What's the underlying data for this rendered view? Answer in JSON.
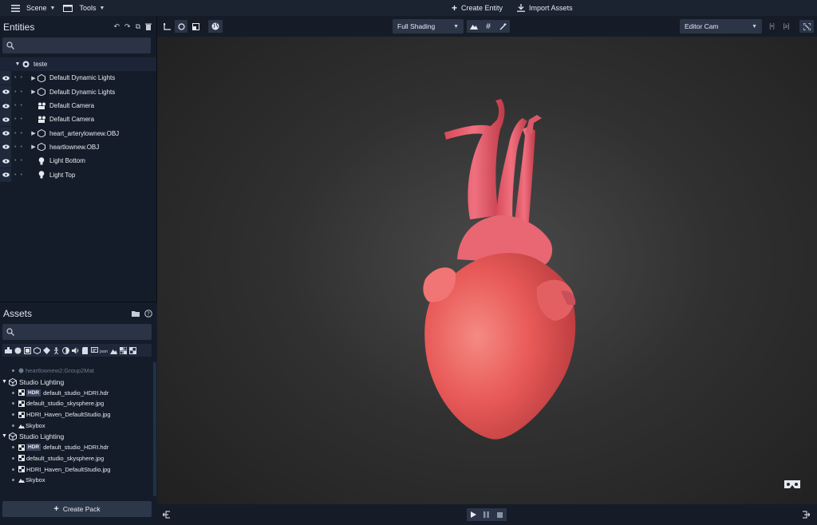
{
  "topbar": {
    "scene_label": "Scene",
    "tools_label": "Tools",
    "create_entity_label": "Create Entity",
    "import_assets_label": "Import Assets"
  },
  "entities": {
    "title": "Entities",
    "search_placeholder": "",
    "root": "teste",
    "items": [
      {
        "label": "Default Dynamic Lights",
        "icon": "cube-icon",
        "expandable": true
      },
      {
        "label": "Default Dynamic Lights",
        "icon": "cube-icon",
        "expandable": true
      },
      {
        "label": "Default Camera",
        "icon": "camera-icon",
        "expandable": false
      },
      {
        "label": "Default Camera",
        "icon": "camera-icon",
        "expandable": false
      },
      {
        "label": "heart_arterylownew.OBJ",
        "icon": "cube-icon",
        "expandable": true
      },
      {
        "label": "heartlownew.OBJ",
        "icon": "cube-icon",
        "expandable": true
      },
      {
        "label": "Light Bottom",
        "icon": "bulb-icon",
        "expandable": false
      },
      {
        "label": "Light Top",
        "icon": "bulb-icon",
        "expandable": false
      }
    ]
  },
  "assets": {
    "title": "Assets",
    "search_placeholder": "",
    "rows": [
      {
        "type": "faded",
        "label": "heartlownew2:Group2Mat"
      },
      {
        "type": "group",
        "label": "Studio Lighting"
      },
      {
        "type": "item",
        "badge": "HDR",
        "label": "default_studio_HDRI.hdr"
      },
      {
        "type": "item",
        "label": "default_studio_skysphere.jpg"
      },
      {
        "type": "item",
        "label": "HDRI_Haven_DefaultStudio.jpg"
      },
      {
        "type": "item",
        "label": "Skybox"
      },
      {
        "type": "group",
        "label": "Studio Lighting"
      },
      {
        "type": "item",
        "badge": "HDR",
        "label": "default_studio_HDRI.hdr"
      },
      {
        "type": "item",
        "label": "default_studio_skysphere.jpg"
      },
      {
        "type": "item",
        "label": "HDRI_Haven_DefaultStudio.jpg"
      },
      {
        "type": "item",
        "label": "Skybox"
      }
    ],
    "create_pack_label": "Create Pack"
  },
  "viewport": {
    "shading_label": "Full Shading",
    "camera_label": "Editor Cam"
  },
  "colors": {
    "accent": "#2b3547",
    "heart": "#e85858"
  }
}
